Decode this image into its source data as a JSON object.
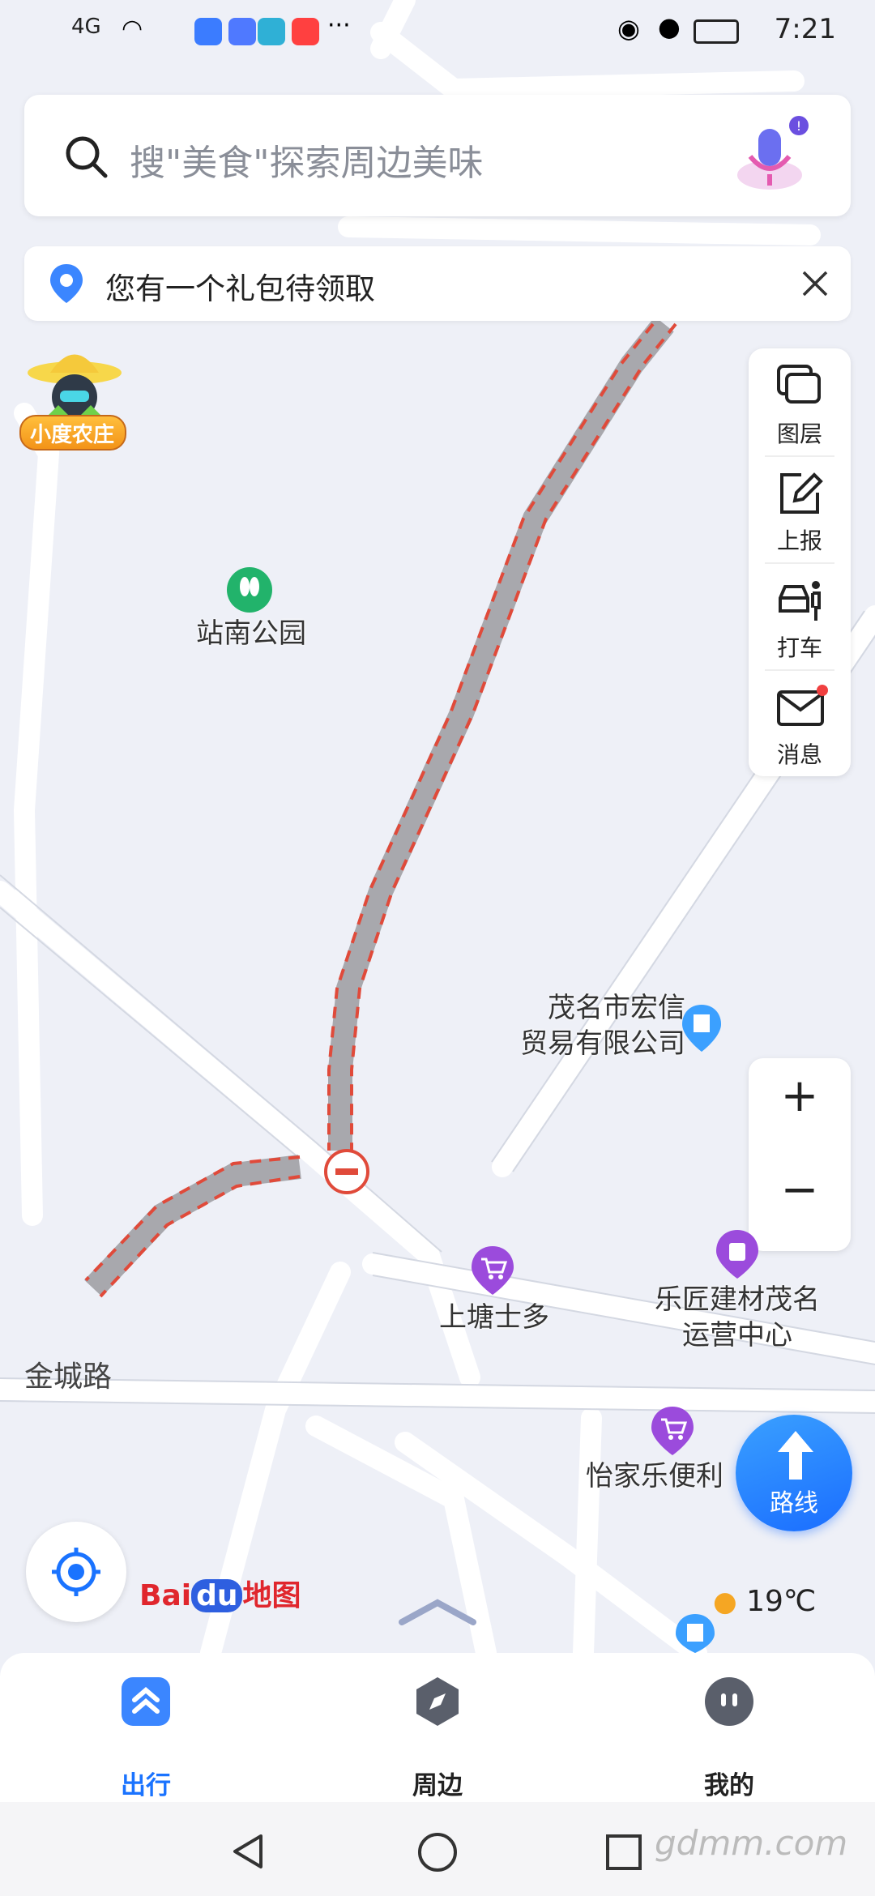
{
  "status_bar": {
    "network": "4G",
    "time": "7:21",
    "app_icon_colors": [
      "#3b7cff",
      "#4f79ff",
      "#2fb0d6",
      "#ff4040"
    ]
  },
  "search": {
    "placeholder": "搜\"美食\"探索周边美味",
    "icons": [
      "search-icon",
      "microphone-icon"
    ]
  },
  "banner": {
    "text": "您有一个礼包待领取"
  },
  "farm_badge": {
    "label": "小度农庄"
  },
  "tools": [
    {
      "label": "图层",
      "icon": "layers-icon"
    },
    {
      "label": "上报",
      "icon": "edit-icon"
    },
    {
      "label": "打车",
      "icon": "taxi-icon"
    },
    {
      "label": "消息",
      "icon": "mail-icon"
    }
  ],
  "zoom": {
    "in": "+",
    "out": "−"
  },
  "map": {
    "park": "站南公园",
    "company": "茂名市宏信\n贸易有限公司",
    "road": "金城路",
    "store1": "上塘士多",
    "store2": "乐匠建材茂名\n运营中心",
    "store3": "怡家乐便利",
    "route_color": "#b0b0b5",
    "route_dash": "#e04a3a"
  },
  "brand": {
    "part1": "Bai",
    "part2": "du",
    "part3": "地图"
  },
  "weather": {
    "temp": "19℃"
  },
  "route_button": {
    "label": "路线"
  },
  "bottom_nav": [
    {
      "label": "出行",
      "active": true
    },
    {
      "label": "周边",
      "active": false
    },
    {
      "label": "我的",
      "active": false
    }
  ],
  "watermark": "gdmm.com"
}
